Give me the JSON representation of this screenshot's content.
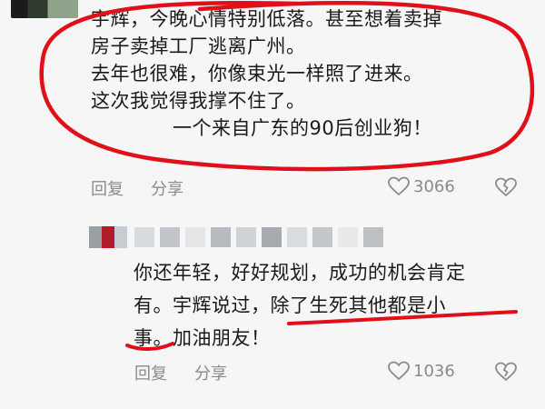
{
  "comment1": {
    "lines": [
      "宇辉，今晚心情特别低落。甚至想着卖掉",
      "房子卖掉工厂逃离广州。",
      "去年也很难，你像束光一样照了进来。",
      "这次我觉得我撑不住了。",
      "一个来自广东的90后创业狗！"
    ],
    "reply_label": "回复",
    "share_label": "分享",
    "like_count": "3066"
  },
  "comment2": {
    "lines": [
      "你还年轻，好好规划，成功的机会肯定",
      "有。宇辉说过，除了生死其他都是小",
      "事。加油朋友！"
    ],
    "reply_label": "回复",
    "share_label": "分享",
    "like_count": "1036"
  },
  "colors": {
    "annotation_red": "#e0101a",
    "meta_gray": "#8a8a8a",
    "text": "#1a1a1a"
  },
  "icons": {
    "like": "heart-outline-icon",
    "dislike": "broken-heart-icon"
  }
}
